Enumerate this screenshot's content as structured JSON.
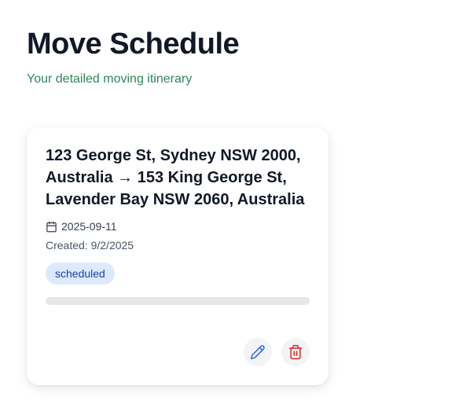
{
  "page": {
    "title": "Move Schedule",
    "subtitle": "Your detailed moving itinerary"
  },
  "move": {
    "route": "123 George St, Sydney NSW 2000, Australia → 153 King George St, Lavender Bay NSW 2060, Australia",
    "date_icon": "calendar-icon",
    "date": "2025-09-11",
    "created": "Created: 9/2/2025",
    "status": "scheduled",
    "progress": 0,
    "actions": {
      "edit_icon": "pencil-icon",
      "delete_icon": "trash-icon"
    }
  },
  "colors": {
    "subtitle": "#2f855a",
    "badge_bg": "#dbeafe",
    "badge_text": "#1e40af",
    "edit_icon": "#2563eb",
    "delete_icon": "#dc2626",
    "progress_track": "#e5e7eb"
  }
}
